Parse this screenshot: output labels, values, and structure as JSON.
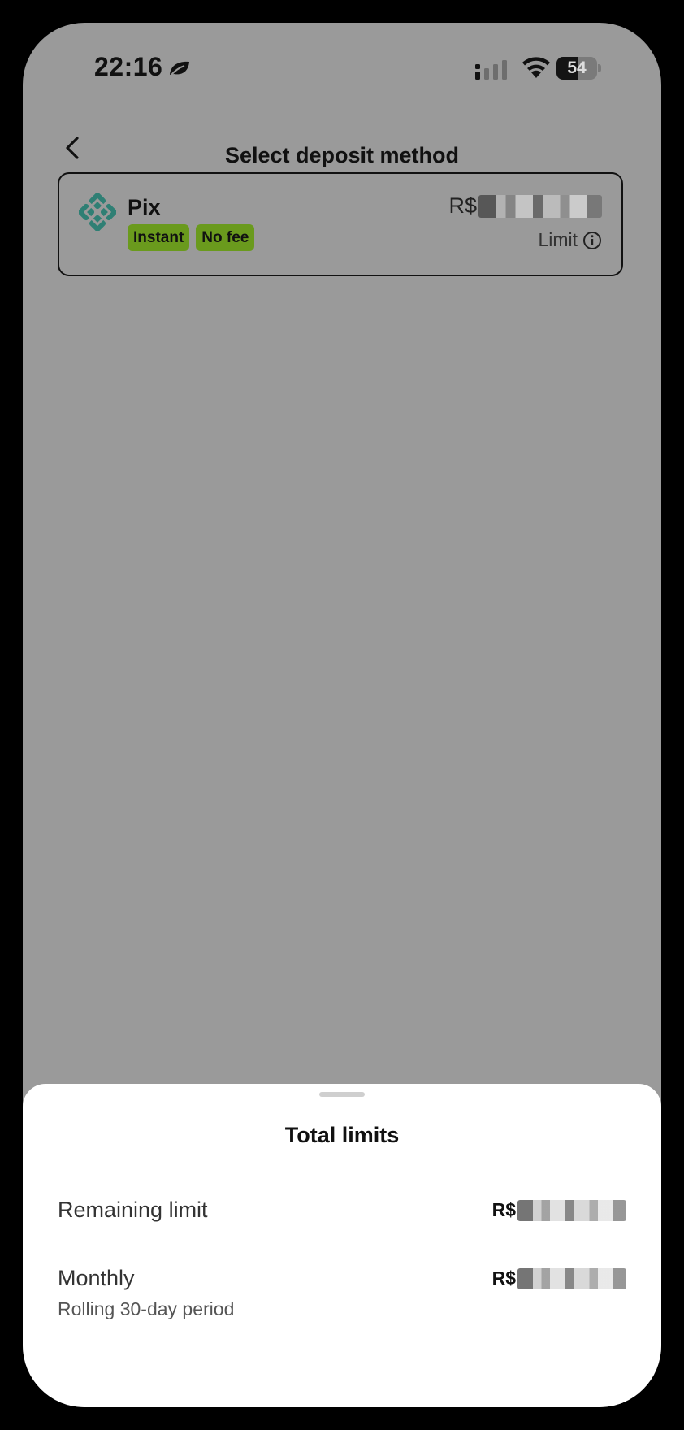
{
  "status_bar": {
    "time": "22:16",
    "battery_level": "54",
    "icons": [
      "leaf-icon",
      "cellular-signal-icon",
      "wifi-icon",
      "battery-icon"
    ]
  },
  "header": {
    "back_icon": "chevron-left-icon",
    "title": "Select deposit method"
  },
  "deposit_methods": [
    {
      "name": "Pix",
      "icon": "pix-logo-icon",
      "badges": [
        "Instant",
        "No fee"
      ],
      "amount_prefix": "R$",
      "amount_redacted": true,
      "limit_label": "Limit",
      "limit_icon": "info-icon"
    }
  ],
  "sheet": {
    "title": "Total limits",
    "rows": [
      {
        "label": "Remaining limit",
        "value_prefix": "R$",
        "value_redacted": true
      },
      {
        "label": "Monthly",
        "sublabel": "Rolling 30-day period",
        "value_prefix": "R$",
        "value_redacted": true
      }
    ]
  },
  "colors": {
    "overlay_background": "#9a9a9a",
    "badge_green": "#6a9a1d",
    "pix_teal": "#32bcad",
    "sheet_background": "#ffffff"
  }
}
